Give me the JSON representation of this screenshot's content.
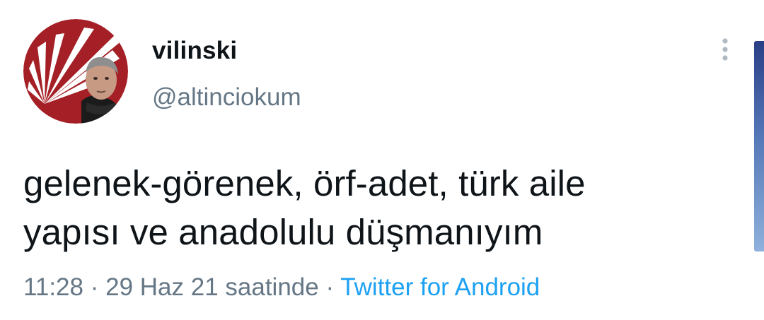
{
  "tweet": {
    "display_name": "vilinski",
    "handle": "@altinciokum",
    "text_line_1": "gelenek-görenek, örf-adet, türk aile",
    "text_line_2": "yapısı ve anadolulu düşmanıyım",
    "time": "11:28",
    "separator": " · ",
    "date": "29 Haz 21 saatinde",
    "source": "Twitter for Android"
  },
  "icons": {
    "avatar": "profile-avatar-icon",
    "more": "more-vertical-icon"
  },
  "colors": {
    "name_text": "#0f1419",
    "secondary_text": "#657786",
    "link": "#1da1f2",
    "avatar_red": "#a52026"
  }
}
